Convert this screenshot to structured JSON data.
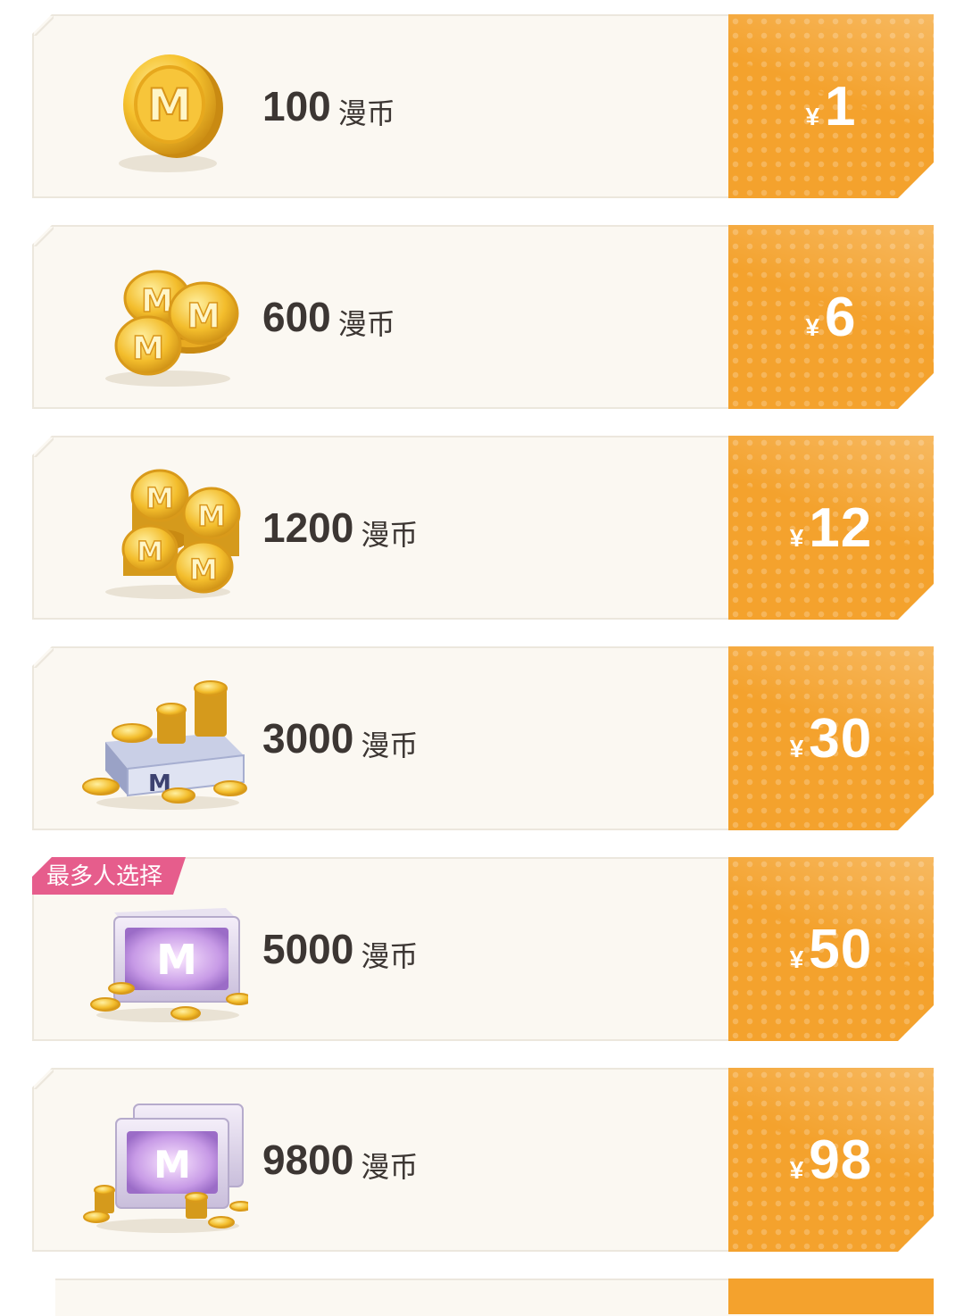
{
  "packages": [
    {
      "amount": "100",
      "unit": "漫币",
      "yen": "¥",
      "price": "1",
      "visual": "single-coin",
      "badge": ""
    },
    {
      "amount": "600",
      "unit": "漫币",
      "yen": "¥",
      "price": "6",
      "visual": "coin-pile-small",
      "badge": ""
    },
    {
      "amount": "1200",
      "unit": "漫币",
      "yen": "¥",
      "price": "12",
      "visual": "coin-stacks",
      "badge": ""
    },
    {
      "amount": "3000",
      "unit": "漫币",
      "yen": "¥",
      "price": "30",
      "visual": "coin-crate",
      "badge": ""
    },
    {
      "amount": "5000",
      "unit": "漫币",
      "yen": "¥",
      "price": "50",
      "visual": "treasure-box",
      "badge": "最多人选择"
    },
    {
      "amount": "9800",
      "unit": "漫币",
      "yen": "¥",
      "price": "98",
      "visual": "double-treasure-box",
      "badge": ""
    }
  ],
  "colors": {
    "accent": "#f4a22d",
    "card_bg": "#fbf8f2",
    "badge": "#e65d8c",
    "text": "#3c3633"
  }
}
